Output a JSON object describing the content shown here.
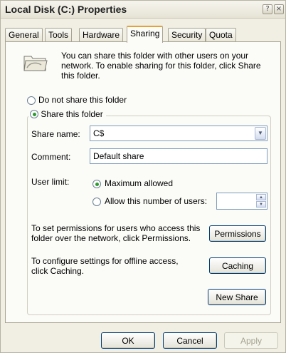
{
  "window": {
    "title": "Local Disk (C:) Properties",
    "help_glyph": "?",
    "close_glyph": "×"
  },
  "tabs": [
    {
      "label": "General"
    },
    {
      "label": "Tools"
    },
    {
      "label": "Hardware"
    },
    {
      "label": "Sharing"
    },
    {
      "label": "Security"
    },
    {
      "label": "Quota"
    }
  ],
  "sharing": {
    "intro": "You can share this folder with other users on your network.  To enable sharing for this folder, click Share this folder.",
    "do_not_share_label": "Do not share this folder",
    "share_label": "Share this folder",
    "share_name_label": "Share name:",
    "share_name_value": "C$",
    "comment_label": "Comment:",
    "comment_value": "Default share",
    "user_limit_label": "User limit:",
    "max_allowed_label": "Maximum allowed",
    "allow_number_label": "Allow this number of users:",
    "allow_number_value": "",
    "permissions_text": "To set permissions for users who access this folder over the network, click Permissions.",
    "permissions_button": "Permissions",
    "caching_text": "To configure settings for offline access, click Caching.",
    "caching_button": "Caching",
    "new_share_button": "New Share"
  },
  "footer": {
    "ok": "OK",
    "cancel": "Cancel",
    "apply": "Apply"
  },
  "icons": {
    "folder": "shared-folder-icon",
    "combo": "chevron-down-icon",
    "spin_up": "spin-up-icon",
    "spin_down": "spin-down-icon"
  }
}
